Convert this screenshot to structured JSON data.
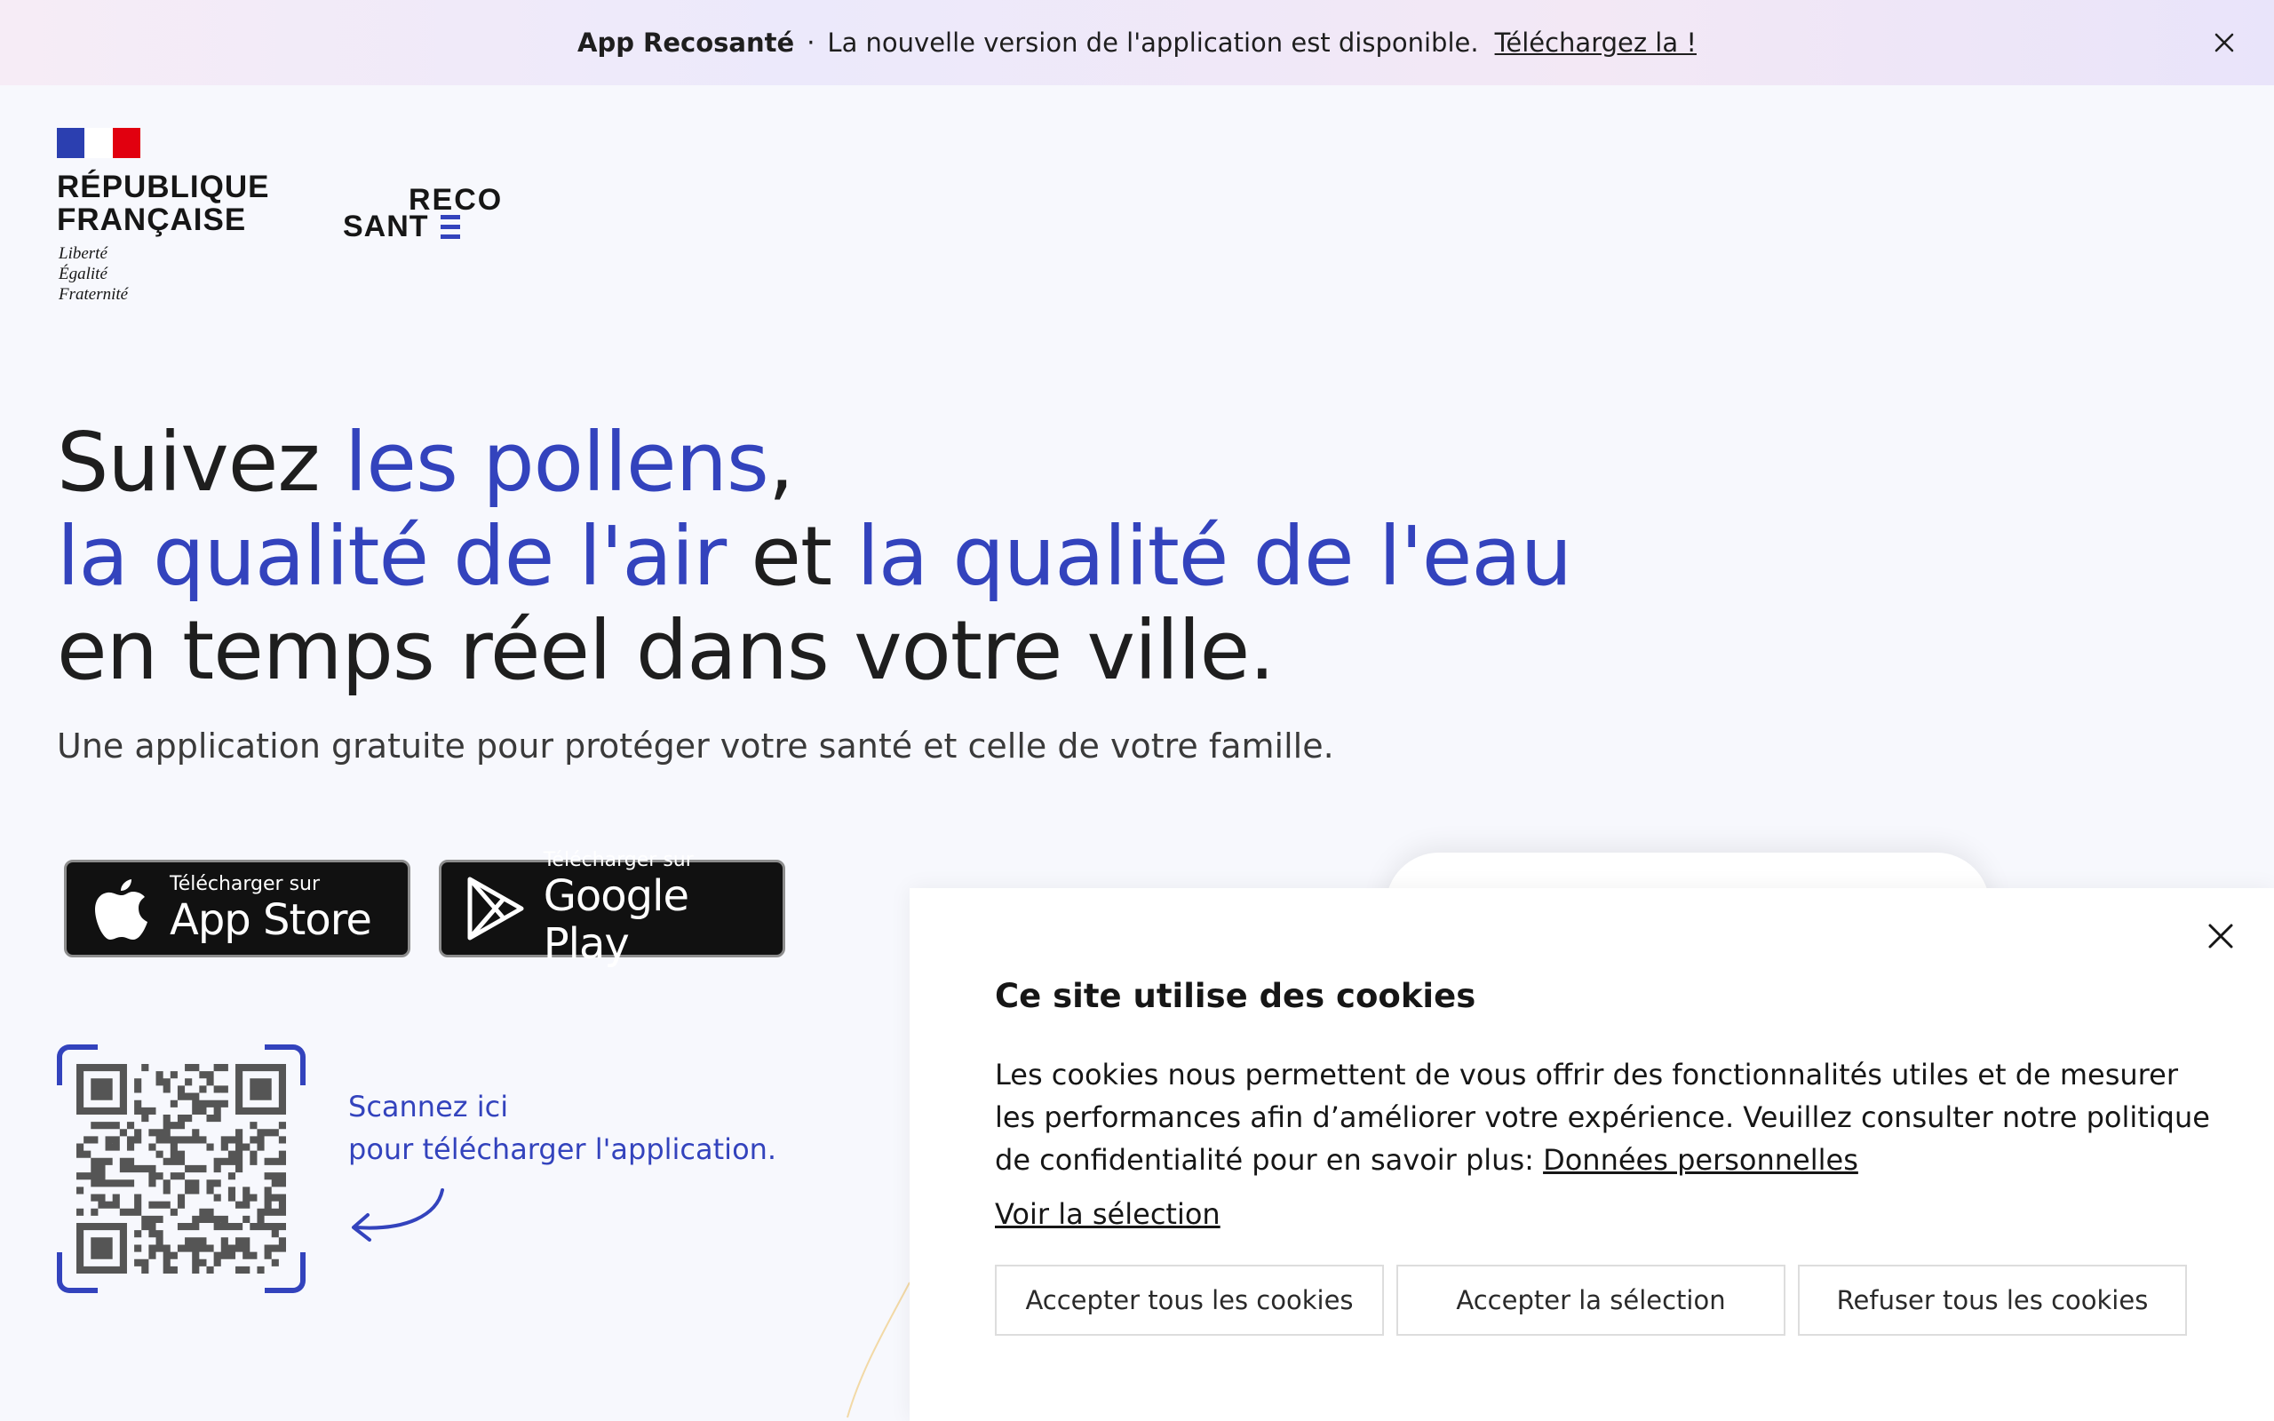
{
  "banner": {
    "app_name": "App Recosanté",
    "separator": "·",
    "message": "La nouvelle version de l'application est disponible.",
    "link": "Téléchargez la !",
    "close_icon": "close-icon"
  },
  "logos": {
    "republique": {
      "line1": "RÉPUBLIQUE",
      "line2": "FRANÇAISE",
      "motto1": "Liberté",
      "motto2": "Égalité",
      "motto3": "Fraternité"
    },
    "recosante": {
      "top": "RECO",
      "bottom": "SANT"
    }
  },
  "hero": {
    "t1": "Suivez ",
    "t2": "les pollens",
    "t3": ",",
    "t4": "la qualité de l'air",
    "t5": " et ",
    "t6": "la qualité de l'eau",
    "t7": "en temps réel dans votre ville.",
    "subtitle": "Une application gratuite pour protéger votre santé et celle de votre famille."
  },
  "stores": {
    "apple": {
      "small": "Télécharger sur",
      "big": "App Store",
      "icon": "apple-icon"
    },
    "google": {
      "small": "Télécharger sur",
      "big": "Google Play",
      "icon": "google-play-icon"
    }
  },
  "qr": {
    "line1": "Scannez ici",
    "line2": "pour télécharger l'application."
  },
  "cookie": {
    "title": "Ce site utilise des cookies",
    "body": "Les cookies nous permettent de vous offrir des fonctionnalités utiles et de mesurer les performances afin d’améliorer votre expérience. Veuillez consulter notre politique de confidentialité pour en savoir plus: ",
    "body_link": "Données personnelles",
    "view_selection": "Voir la sélection",
    "accept_all": "Accepter tous les cookies",
    "accept_selection": "Accepter la sélection",
    "refuse_all": "Refuser tous les cookies"
  },
  "colors": {
    "accent": "#3343bd",
    "text": "#1e1e1e",
    "background": "#f7f8fd"
  }
}
